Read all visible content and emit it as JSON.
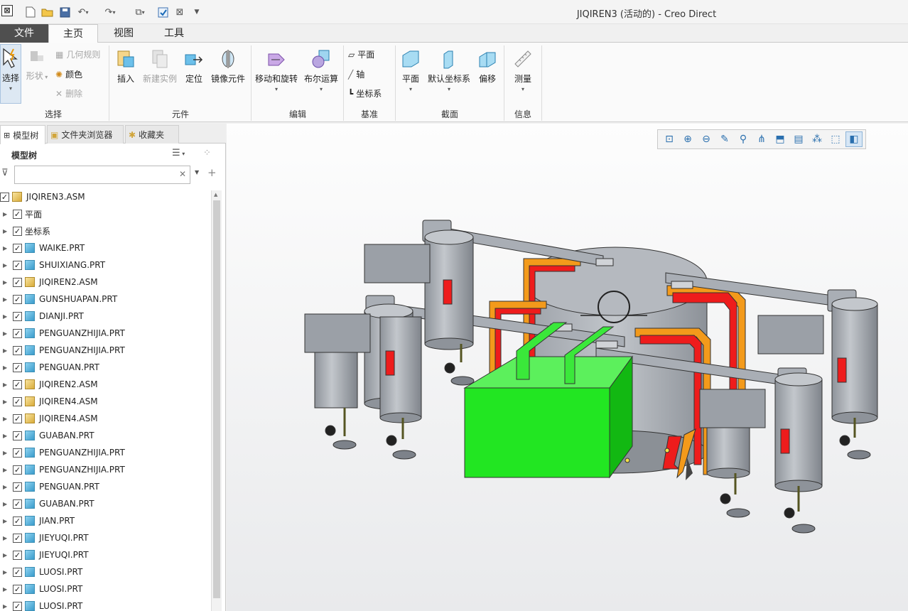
{
  "window": {
    "title": "JIQIREN3 (活动的) - Creo Direct"
  },
  "quick_access": [
    {
      "name": "new-icon"
    },
    {
      "name": "open-icon"
    },
    {
      "name": "save-icon"
    },
    {
      "name": "undo-icon"
    },
    {
      "name": "redo-icon"
    },
    {
      "name": "windows-icon"
    },
    {
      "name": "regenerate-icon"
    },
    {
      "name": "close-window-icon"
    },
    {
      "name": "customize-icon"
    }
  ],
  "tabs": {
    "file": "文件",
    "home": "主页",
    "view": "视图",
    "tools": "工具"
  },
  "ribbon": {
    "select": "选择",
    "shape": "形状",
    "geometry_rule": "几何规则",
    "color": "颜色",
    "delete": "删除",
    "insert": "插入",
    "new_instance": "新建实例",
    "locate": "定位",
    "mirror_component": "镜像元件",
    "move_rotate": "移动和旋转",
    "boolean": "布尔运算",
    "plane_small": "平面",
    "axis": "轴",
    "csys": "坐标系",
    "section_plane": "平面",
    "default_csys": "默认坐标系",
    "offset": "偏移",
    "measure": "测量",
    "groups": {
      "select": "选择",
      "component": "元件",
      "edit": "编辑",
      "datum": "基准",
      "section": "截面",
      "info": "信息"
    }
  },
  "panel": {
    "tabs": {
      "model_tree": "模型树",
      "folder_browser": "文件夹浏览器",
      "favorites": "收藏夹"
    },
    "tree_title": "模型树",
    "filter_value": "",
    "items": [
      {
        "label": "JIQIREN3.ASM",
        "type": "asm",
        "root": true
      },
      {
        "label": "平面",
        "type": "feat"
      },
      {
        "label": "坐标系",
        "type": "feat"
      },
      {
        "label": "WAIKE.PRT",
        "type": "prt"
      },
      {
        "label": "SHUIXIANG.PRT",
        "type": "prt"
      },
      {
        "label": "JIQIREN2.ASM",
        "type": "asm"
      },
      {
        "label": "GUNSHUAPAN.PRT",
        "type": "prt"
      },
      {
        "label": "DIANJI.PRT",
        "type": "prt"
      },
      {
        "label": "PENGUANZHIJIA.PRT",
        "type": "prt"
      },
      {
        "label": "PENGUANZHIJIA.PRT",
        "type": "prt"
      },
      {
        "label": "PENGUAN.PRT",
        "type": "prt"
      },
      {
        "label": "JIQIREN2.ASM",
        "type": "asm"
      },
      {
        "label": "JIQIREN4.ASM",
        "type": "asm"
      },
      {
        "label": "JIQIREN4.ASM",
        "type": "asm"
      },
      {
        "label": "GUABAN.PRT",
        "type": "prt"
      },
      {
        "label": "PENGUANZHIJIA.PRT",
        "type": "prt"
      },
      {
        "label": "PENGUANZHIJIA.PRT",
        "type": "prt"
      },
      {
        "label": "PENGUAN.PRT",
        "type": "prt"
      },
      {
        "label": "GUABAN.PRT",
        "type": "prt"
      },
      {
        "label": "JIAN.PRT",
        "type": "prt"
      },
      {
        "label": "JIEYUQI.PRT",
        "type": "prt"
      },
      {
        "label": "JIEYUQI.PRT",
        "type": "prt"
      },
      {
        "label": "LUOSI.PRT",
        "type": "prt"
      },
      {
        "label": "LUOSI.PRT",
        "type": "prt"
      },
      {
        "label": "LUOSI.PRT",
        "type": "prt"
      }
    ]
  },
  "view_toolbar": [
    {
      "name": "refit-icon"
    },
    {
      "name": "zoom-in-icon"
    },
    {
      "name": "zoom-out-icon"
    },
    {
      "name": "repaint-icon"
    },
    {
      "name": "display-style-icon"
    },
    {
      "name": "saved-views-icon"
    },
    {
      "name": "named-views-icon"
    },
    {
      "name": "section-icon"
    },
    {
      "name": "datum-display-icon"
    },
    {
      "name": "spin-center-icon"
    },
    {
      "name": "shaded-icon",
      "active": true
    }
  ],
  "colors": {
    "green_body": "#22e622",
    "robot_gray": "#a9aeb5",
    "red": "#ee1c1c",
    "orange": "#f39a1b"
  }
}
